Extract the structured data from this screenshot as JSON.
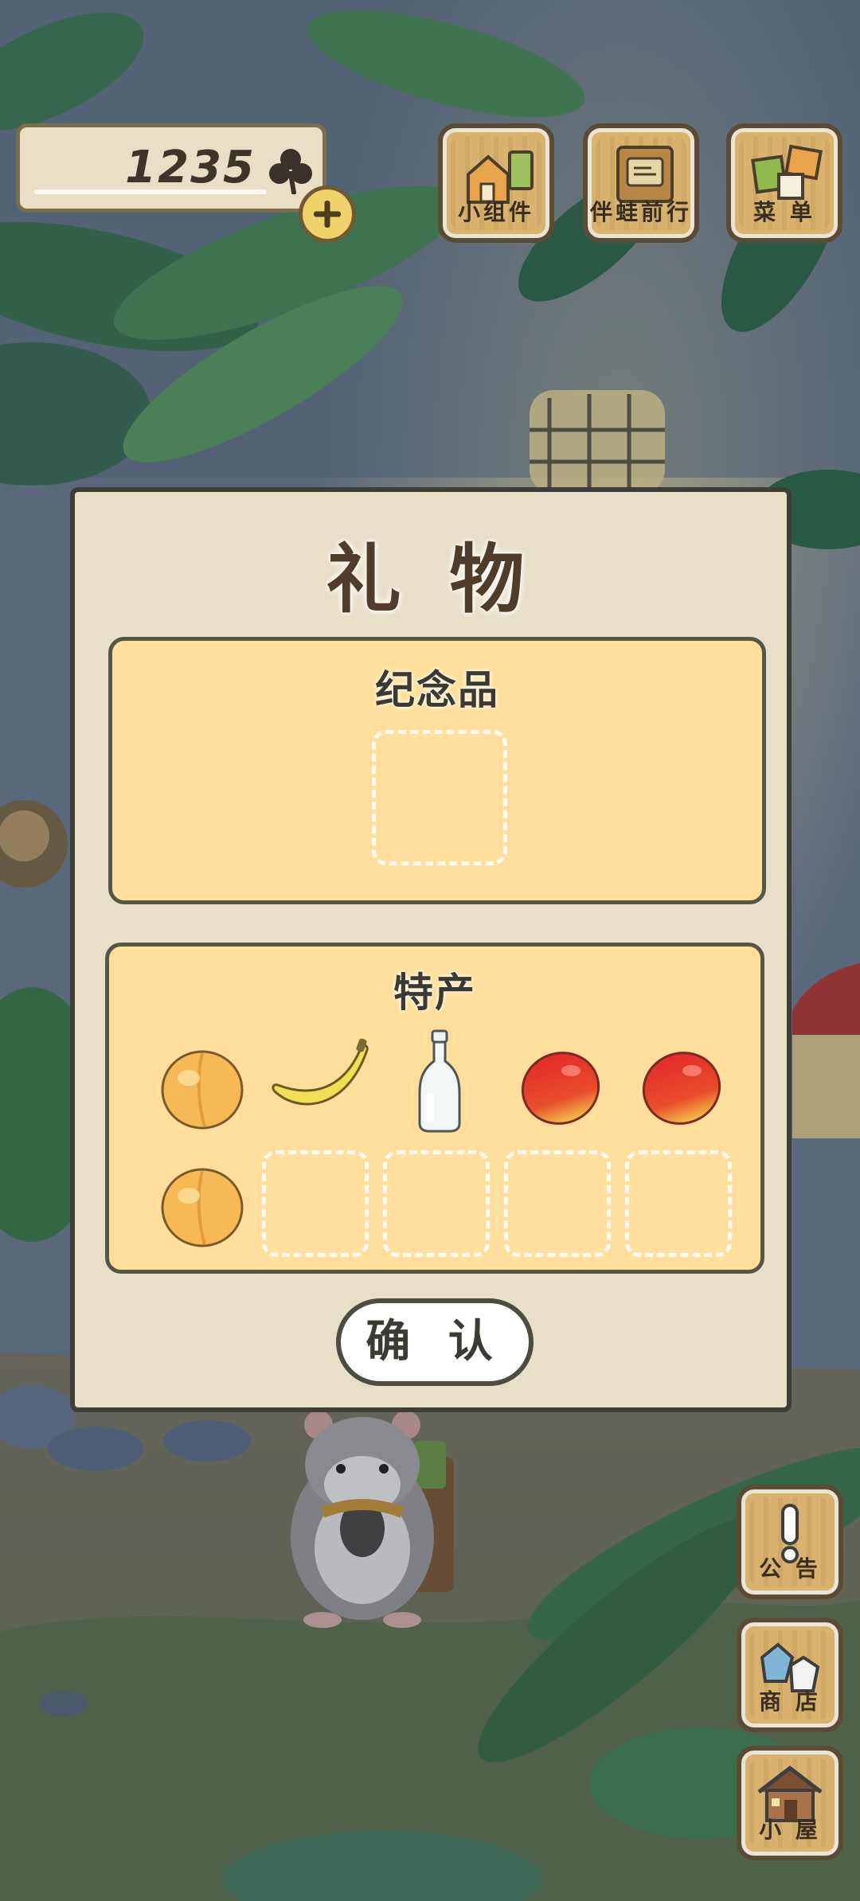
{
  "hud": {
    "clover_count": "1235",
    "buttons": {
      "widgets": "小组件",
      "travel": "伴蛙前行",
      "menu": "菜 单"
    },
    "side_buttons": {
      "notice": "公 告",
      "shop": "商 店",
      "house": "小 屋"
    }
  },
  "gift_dialog": {
    "title": "礼 物",
    "souvenir": {
      "title": "纪念品",
      "items": []
    },
    "specialty": {
      "title": "特产",
      "items": [
        "peach",
        "banana",
        "glass-bottle",
        "mango",
        "mango",
        "peach"
      ],
      "empty_slots": 4
    },
    "confirm_label": "确 认"
  },
  "colors": {
    "dialog_bg": "#e7dfc6",
    "panel_bg": "#ffdf9b",
    "border": "#3e3e39",
    "wood": "#d9b36e"
  }
}
